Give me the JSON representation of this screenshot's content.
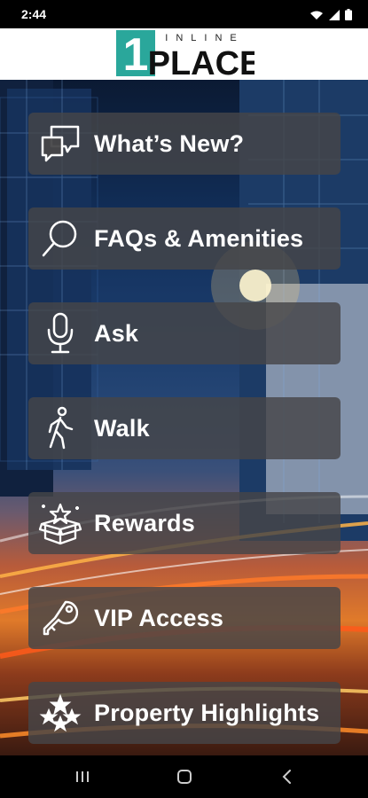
{
  "status_bar": {
    "time": "2:44"
  },
  "logo": {
    "mark": "1",
    "top_text": "INLINE",
    "main_text": "PLACE"
  },
  "menu": [
    {
      "label": "What’s New?",
      "icon": "speech-bubbles-icon"
    },
    {
      "label": "FAQs & Amenities",
      "icon": "search-icon"
    },
    {
      "label": "Ask",
      "icon": "microphone-icon"
    },
    {
      "label": "Walk",
      "icon": "walking-person-icon"
    },
    {
      "label": "Rewards",
      "icon": "gift-box-stars-icon"
    },
    {
      "label": "VIP Access",
      "icon": "key-icon"
    },
    {
      "label": "Property Highlights",
      "icon": "stars-icon"
    }
  ],
  "nav": {
    "recents": "recents-icon",
    "home": "home-icon",
    "back": "back-icon"
  }
}
